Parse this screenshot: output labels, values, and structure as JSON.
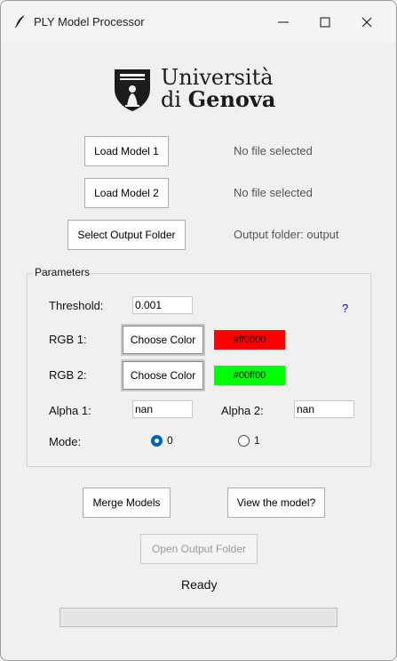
{
  "window": {
    "title": "PLY Model Processor"
  },
  "logo": {
    "line1": "Università",
    "line2_prefix": "di ",
    "line2_bold": "Genova"
  },
  "files": {
    "load1_label": "Load Model 1",
    "load1_status": "No file selected",
    "load2_label": "Load Model 2",
    "load2_status": "No file selected",
    "output_label": "Select Output Folder",
    "output_status": "Output folder: output"
  },
  "parameters": {
    "group_title": "Parameters",
    "threshold_label": "Threshold:",
    "threshold_value": "0.001",
    "help": "?",
    "rgb1_label": "RGB 1:",
    "rgb1_button": "Choose Color",
    "rgb1_value": "#ff0000",
    "rgb2_label": "RGB 2:",
    "rgb2_button": "Choose Color",
    "rgb2_value": "#00ff00",
    "alpha1_label": "Alpha 1:",
    "alpha1_value": "nan",
    "alpha2_label": "Alpha 2:",
    "alpha2_value": "nan",
    "mode_label": "Mode:",
    "mode_options": [
      "0",
      "1"
    ],
    "mode_selected": "0"
  },
  "actions": {
    "merge_label": "Merge Models",
    "view_label": "View the model?",
    "open_output_label": "Open Output Folder"
  },
  "status": {
    "text": "Ready",
    "progress": 0
  },
  "colors": {
    "radio_accent": "#0063b1",
    "help_link": "#0000ee"
  }
}
